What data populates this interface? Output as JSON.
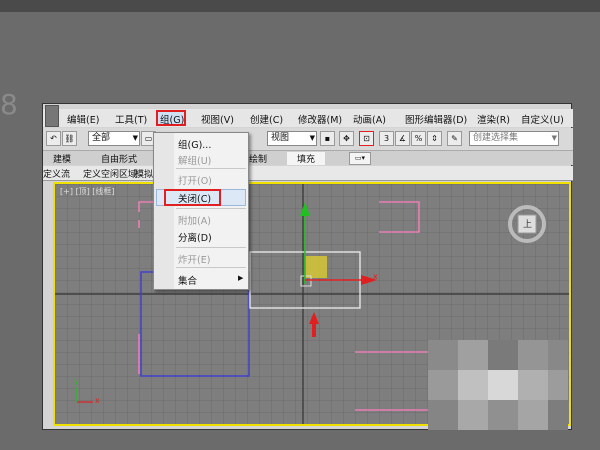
{
  "menu": {
    "edit": "编辑(E)",
    "tools": "工具(T)",
    "group": "组(G)",
    "views": "视图(V)",
    "create": "创建(C)",
    "modifiers": "修改器(M)",
    "animation": "动画(A)",
    "graph_editors": "图形编辑器(D)",
    "rendering": "渲染(R)",
    "customize": "自定义(U)"
  },
  "toolbar": {
    "filter_value": "全部",
    "view_value": "视图",
    "selection_set_placeholder": "创建选择集",
    "snap_label": "3"
  },
  "ribbon": {
    "tab_modeling": "建模",
    "tab_freeform": "自由形式",
    "tab_paint": "绘制",
    "tab_populate": "填充"
  },
  "ribbon_sub": {
    "define_flows": "定义流",
    "define_idle_areas": "定义空闲区域",
    "simulate": "模拟"
  },
  "viewport": {
    "label": "[+] [顶] [线框]",
    "viewcube_label": "上",
    "gizmo_x_label": "x",
    "axis_y": "y",
    "axis_x": "x"
  },
  "group_menu": {
    "group": "组(G)...",
    "ungroup": "解组(U)",
    "open": "打开(O)",
    "close": "关闭(C)",
    "attach": "附加(A)",
    "detach": "分离(D)",
    "explode": "炸开(E)",
    "assembly": "集合"
  },
  "colors": {
    "highlight_border": "#e02020",
    "viewport_border": "#f0e000",
    "gizmo_y": "#20c020",
    "gizmo_x": "#e02020"
  }
}
